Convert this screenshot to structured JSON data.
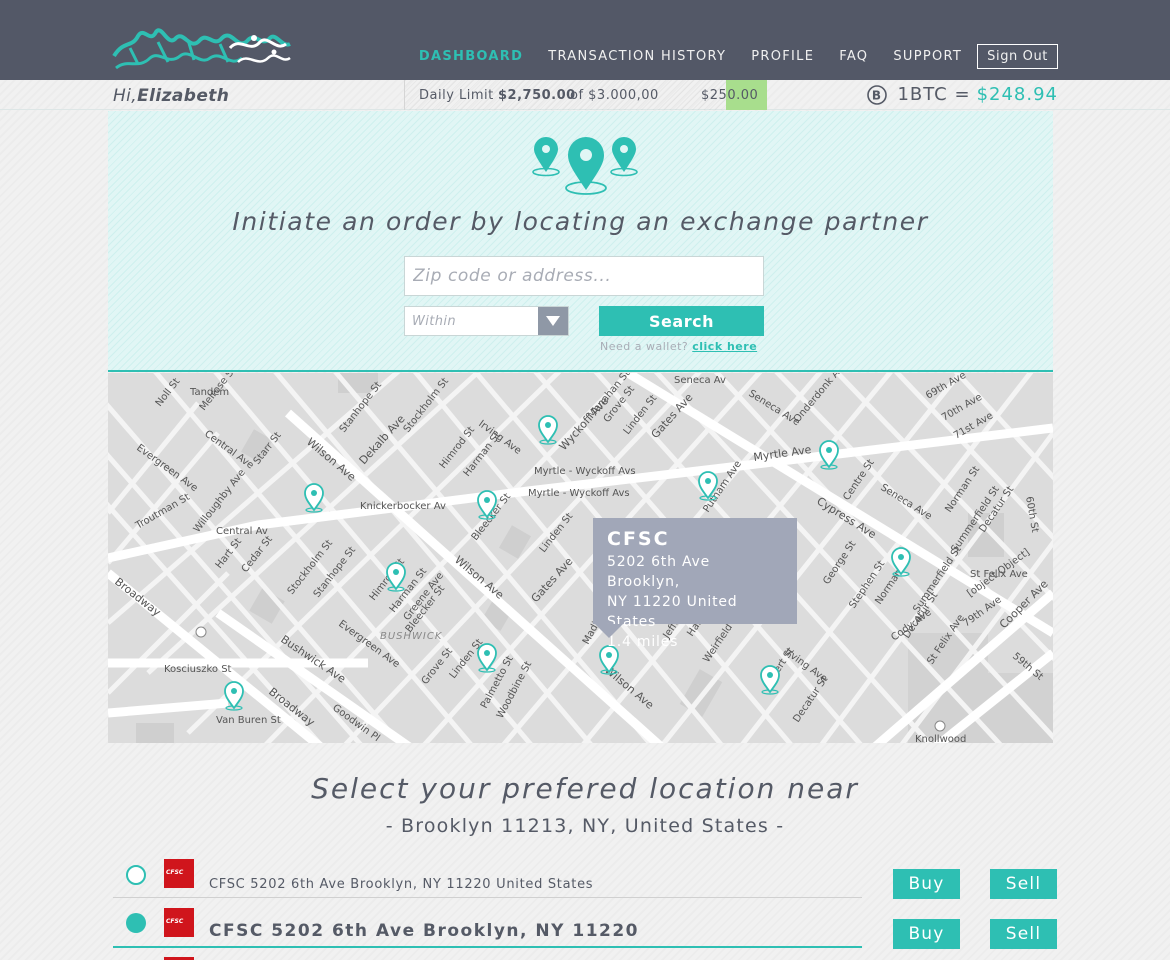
{
  "nav": {
    "items": [
      "DASHBOARD",
      "TRANSACTION HISTORY",
      "PROFILE",
      "FAQ",
      "SUPPORT"
    ],
    "active": "DASHBOARD",
    "sign_out": "Sign Out"
  },
  "strip": {
    "hi": "Hi,",
    "name": "Elizabeth",
    "limit_label": "Daily Limit",
    "limit_used": "$2,750.00",
    "limit_of": "of $3.000,00",
    "limit_remaining": "$250.00",
    "limit_used_fraction": 0.917,
    "btc_label": "1BTC =",
    "btc_price": "$248.94"
  },
  "hero": {
    "title": "Initiate an order by locating an exchange partner",
    "search_placeholder": "Zip code or address...",
    "within_placeholder": "Within",
    "search_button": "Search",
    "wallet_prompt": "Need a wallet?",
    "wallet_link": "click here"
  },
  "map": {
    "labels": {
      "tandem": "Tandem",
      "seneca": "Seneca Av",
      "myrtle_wyckoff1": "Myrtle - Wyckoff Avs",
      "myrtle_wyckoff2": "Myrtle - Wyckoff Avs",
      "knickerbocker": "Knickerbocker Av",
      "central": "Central Av",
      "bushwick": "BUSHWICK",
      "kosciuszko": "Kosciuszko St",
      "knollwood": "Knollwood",
      "myrtle_ave": "Myrtle Ave",
      "wilson_ave": "Wilson Ave",
      "dekalb_ave": "Dekalb Ave",
      "wyckoff_ave": "Wyckoff Ave",
      "gates_ave": "Gates Ave",
      "cypress_ave": "Cypress Ave",
      "broadway": "Broadway",
      "bushwick_ave": "Bushwick Ave",
      "cooper_ave": "Cooper Ave",
      "irving_ave": "Irving Ave",
      "seneca_ave": "Seneca Ave",
      "evergreen_ave": "Evergreen Ave",
      "central_ave": "Central Ave",
      "stanhope_st": "Stanhope St",
      "himrod_st": "Himrod St",
      "harman_st": "Harman St",
      "linden_st": "Linden St",
      "grove_st": "Grove St",
      "palmetto_st": "Palmetto St",
      "woodbine_st": "Woodbine St",
      "madison_st": "Madison St",
      "putnam_ave": "Putnam Ave",
      "george_st": "George St",
      "stephen_st": "Stephen St",
      "norman_st": "Norman St",
      "summerfield_st": "Summerfield St",
      "decatur_st": "Decatur St",
      "cody_ave": "Cody Ave",
      "78th_ave": "78th Ave",
      "79th_ave": "79th Ave",
      "70th_ave": "70th Ave",
      "71st_ave": "71st Ave",
      "69th_ave": "69th Ave",
      "troutman_st": "Troutman St",
      "starr_st": "Starr St",
      "melrose_st": "Melrose St",
      "willoughby_ave": "Willoughby Ave",
      "hart_st": "Hart St",
      "cedar_st": "Cedar St",
      "greene_ave": "Greene Ave",
      "van_buren_st": "Van Buren St",
      "goodwin_pl": "Goodwin Pl",
      "jefferson_st": "Jefferson St",
      "hancock_st": "Hancock St",
      "weirfield_st": "Weirfield St",
      "covert_st": "Covert St",
      "st_felix_ave": "St Felix Ave",
      "59th_st": "59th St",
      "60th_st": "60th St",
      "centre_st": "Centre St",
      "onderdonk_ave": "Onderdonk Ave",
      "menahan_st": "Menahan St",
      "stockholm_st": "Stockholm St",
      "noll_st": "Noll St",
      "bleecker_st": "Bleecker St",
      "st_felix_ave2": "St Felix Ave"
    },
    "tooltip": {
      "name": "CFSC",
      "address_line1": "5202 6th Ave Brooklyn,",
      "address_line2": "NY 11220 United States",
      "distance": "1.4 miles"
    }
  },
  "select": {
    "title": "Select your prefered location near",
    "subtitle": "- Brooklyn 11213,  NY, United States -",
    "rows": [
      {
        "brand": "CFSC",
        "address": "CFSC 5202 6th Ave Brooklyn, NY 11220 United States",
        "selected": false
      },
      {
        "brand": "CFSC",
        "address": "CFSC 5202 6th Ave Brooklyn, NY 11220",
        "selected": true
      }
    ],
    "buy_label": "Buy",
    "sell_label": "Sell"
  },
  "colors": {
    "accent": "#2ebfb3",
    "header": "#535867",
    "tooltip": "#a1a7b8",
    "brand_red": "#d0151c",
    "limit_fill": "#a8de8d"
  }
}
